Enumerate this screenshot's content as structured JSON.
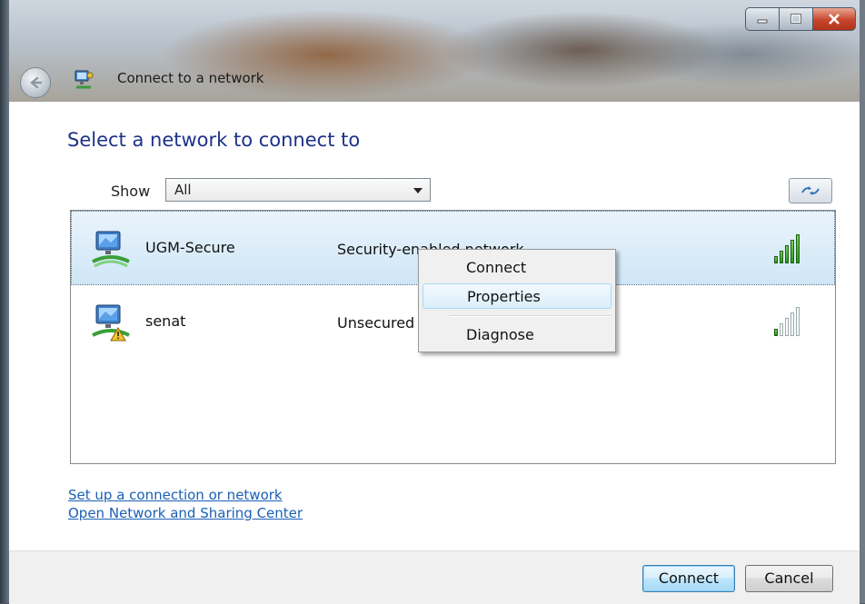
{
  "window": {
    "title": "Connect to a network",
    "back_icon": "back-arrow-icon",
    "app_icon": "network-connect-icon",
    "caption_buttons": [
      "minimize-icon",
      "maximize-icon",
      "close-icon"
    ]
  },
  "main": {
    "heading": "Select a network to connect to",
    "show_label": "Show",
    "show_value": "All",
    "refresh_icon": "refresh-icon"
  },
  "networks": [
    {
      "name": "UGM-Secure",
      "security": "Security-enabled network",
      "signal_bars": 5,
      "signal_max": 5,
      "selected": true,
      "icon": "secure-network-icon"
    },
    {
      "name": "senat",
      "security": "Unsecured network",
      "signal_bars": 1,
      "signal_max": 5,
      "selected": false,
      "icon": "unsecured-network-icon"
    }
  ],
  "context_menu": {
    "items": [
      "Connect",
      "Properties",
      "Diagnose"
    ],
    "highlighted": "Properties"
  },
  "links": {
    "setup": "Set up a connection or network",
    "sharing_center": "Open Network and Sharing Center"
  },
  "buttons": {
    "connect": "Connect",
    "cancel": "Cancel"
  }
}
